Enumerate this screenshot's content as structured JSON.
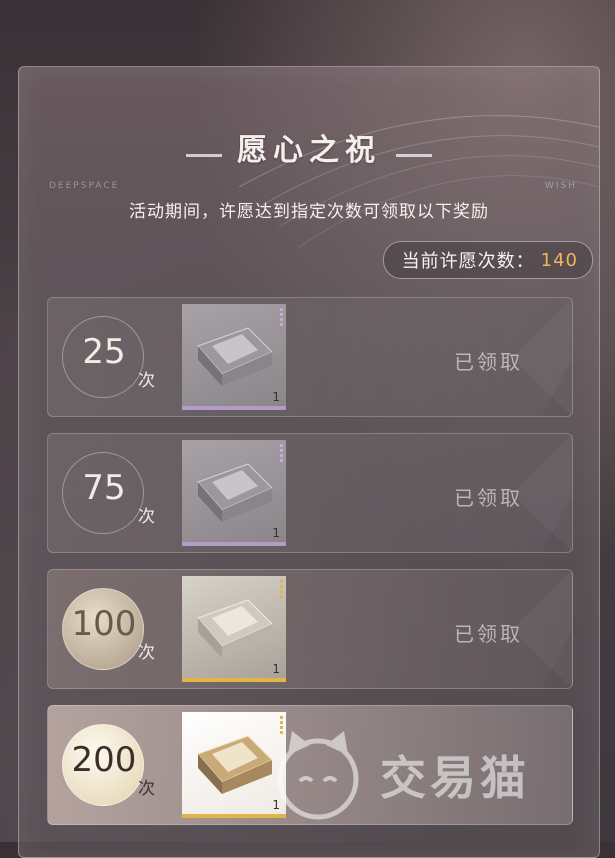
{
  "header": {
    "title": "愿心之祝",
    "tag_left": "DEEPSPACE",
    "tag_right": "WISH",
    "subtitle": "活动期间，许愿达到指定次数可领取以下奖励"
  },
  "counter": {
    "label": "当前许愿次数：",
    "value": "140"
  },
  "rewards": [
    {
      "count": "25",
      "unit": "次",
      "quantity": "1",
      "status": "已领取",
      "rarity": "purple"
    },
    {
      "count": "75",
      "unit": "次",
      "quantity": "1",
      "status": "已领取",
      "rarity": "purple"
    },
    {
      "count": "100",
      "unit": "次",
      "quantity": "1",
      "status": "已领取",
      "rarity": "gold"
    },
    {
      "count": "200",
      "unit": "次",
      "quantity": "1",
      "status": "",
      "rarity": "gold"
    }
  ],
  "watermark": {
    "text": "交易猫",
    "icon": "cat-face-icon"
  },
  "colors": {
    "accent": "#f2b55a",
    "purple_rarity": "#b49ac6",
    "gold_rarity": "#e0b54a"
  }
}
